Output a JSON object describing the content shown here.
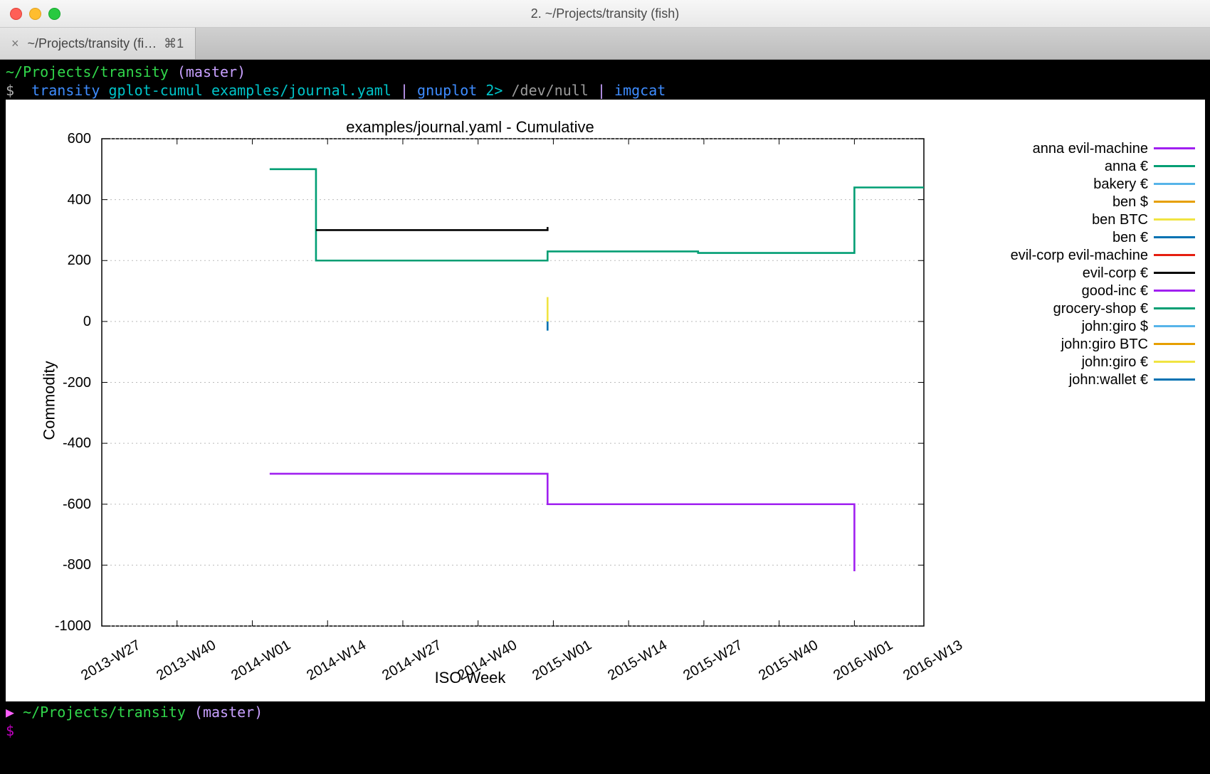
{
  "window": {
    "title": "2. ~/Projects/transity (fish)",
    "tab": {
      "close": "×",
      "label": "~/Projects/transity (fi…",
      "kbd": "⌘1"
    }
  },
  "terminal": {
    "line1": {
      "path": "~/Projects/transity",
      "branch": "(master)"
    },
    "line2": {
      "prompt": "$",
      "bin": "transity",
      "sub": "gplot-cumul",
      "file": "examples/journal.yaml",
      "pipe1": "|",
      "gnuplot": "gnuplot",
      "redir": "2>",
      "devnull": "/dev/null",
      "pipe2": "|",
      "imgcat": "imgcat"
    },
    "line3": {
      "caret": "▶",
      "path": "~/Projects/transity",
      "branch": "(master)"
    },
    "line4": {
      "prompt": "$"
    }
  },
  "chart_data": {
    "type": "line",
    "title": "examples/journal.yaml - Cumulative",
    "xlabel": "ISO Week",
    "ylabel": "Commodity",
    "ylim": [
      -1000,
      600
    ],
    "x_categories": [
      "2013-W27",
      "2013-W40",
      "2014-W01",
      "2014-W14",
      "2014-W27",
      "2014-W40",
      "2015-W01",
      "2015-W14",
      "2015-W27",
      "2015-W40",
      "2016-W01",
      "2016-W13"
    ],
    "y_ticks": [
      600,
      400,
      200,
      0,
      -200,
      -400,
      -600,
      -800,
      -1000
    ],
    "legend": [
      {
        "name": "anna evil-machine",
        "color": "#a020f0"
      },
      {
        "name": "anna €",
        "color": "#009e73"
      },
      {
        "name": "bakery €",
        "color": "#56b4e9"
      },
      {
        "name": "ben $",
        "color": "#e69f00"
      },
      {
        "name": "ben BTC",
        "color": "#f0e442"
      },
      {
        "name": "ben €",
        "color": "#0072b2"
      },
      {
        "name": "evil-corp evil-machine",
        "color": "#e51e10"
      },
      {
        "name": "evil-corp €",
        "color": "#000000"
      },
      {
        "name": "good-inc €",
        "color": "#a020f0"
      },
      {
        "name": "grocery-shop €",
        "color": "#009e73"
      },
      {
        "name": "john:giro $",
        "color": "#56b4e9"
      },
      {
        "name": "john:giro BTC",
        "color": "#e69f00"
      },
      {
        "name": "john:giro €",
        "color": "#f0e442"
      },
      {
        "name": "john:wallet €",
        "color": "#0072b2"
      }
    ],
    "series": [
      {
        "name": "anna €",
        "color": "#009e73",
        "points": [
          [
            "2014-W04",
            500
          ],
          [
            "2014-W12",
            500
          ],
          [
            "2014-W12",
            200
          ],
          [
            "2014-W52",
            200
          ],
          [
            "2014-W52",
            230
          ],
          [
            "2015-W26",
            230
          ],
          [
            "2015-W26",
            225
          ],
          [
            "2016-W01",
            225
          ],
          [
            "2016-W01",
            440
          ],
          [
            "2016-W13",
            440
          ]
        ]
      },
      {
        "name": "evil-corp €",
        "color": "#000000",
        "points": [
          [
            "2014-W12",
            300
          ],
          [
            "2014-W52",
            300
          ],
          [
            "2014-W52",
            310
          ]
        ],
        "vertical_end": true
      },
      {
        "name": "good-inc €",
        "color": "#a020f0",
        "points": [
          [
            "2014-W04",
            -500
          ],
          [
            "2014-W52",
            -500
          ],
          [
            "2014-W52",
            -600
          ],
          [
            "2016-W01",
            -600
          ],
          [
            "2016-W01",
            -820
          ]
        ]
      },
      {
        "name": "john:giro €",
        "color": "#f0e442",
        "points": [
          [
            "2014-W52",
            0
          ],
          [
            "2014-W52",
            80
          ]
        ]
      },
      {
        "name": "john:wallet €",
        "color": "#0072b2",
        "points": [
          [
            "2014-W52",
            0
          ],
          [
            "2014-W52",
            -30
          ]
        ]
      }
    ]
  }
}
